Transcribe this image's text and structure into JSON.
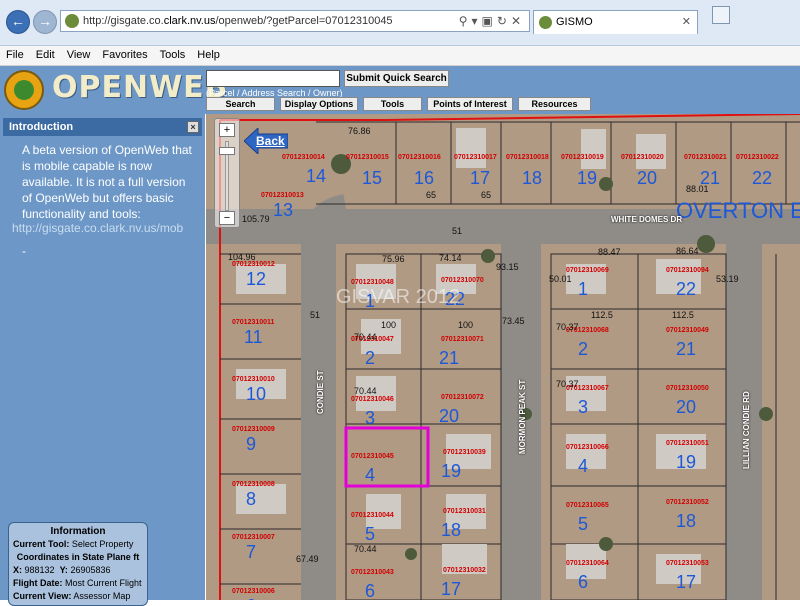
{
  "browser": {
    "url_prefix": "http://gisgate.co.",
    "url_host": "clark.nv.us",
    "url_suffix": "/openweb/?getParcel=07012310045",
    "tab_title": "GISMO",
    "menu": [
      "File",
      "Edit",
      "View",
      "Favorites",
      "Tools",
      "Help"
    ]
  },
  "app": {
    "brand": "OPENWEB",
    "search_placeholder": "",
    "submit_label": "Submit Quick Search",
    "search_hint": "(Parcel / Address Search / Owner)",
    "nav": [
      "Search",
      "Display Options",
      "Tools",
      "Points of Interest",
      "Resources"
    ]
  },
  "intro": {
    "title": "Introduction",
    "text": "A beta version of OpenWeb that is mobile capable is now available. It is not a full version of OpenWeb but offers basic functionality and tools:",
    "link": "http://gisgate.co.clark.nv.us/mob",
    "dash": "-"
  },
  "info": {
    "title": "Information",
    "current_tool_label": "Current Tool:",
    "current_tool": "Select Property",
    "coords_title": "Coordinates in State Plane ft",
    "x_label": "X:",
    "x": "988132",
    "y_label": "Y:",
    "y": "26905836",
    "flight_label": "Flight Date:",
    "flight": "Most Current Flight",
    "view_label": "Current View:",
    "view": "Assessor Map"
  },
  "map": {
    "back_label": "Back",
    "overton": "OVERTON E",
    "watermark": "GISVAR 2012",
    "streets": [
      "WHITE DOMES DR",
      "CONDIE ST",
      "MORMON PEAK ST",
      "LILLIAN CONDIE RD"
    ],
    "parcels": [
      {
        "id": "07012310014",
        "lot": "14"
      },
      {
        "id": "07012310015",
        "lot": "15"
      },
      {
        "id": "07012310016",
        "lot": "16"
      },
      {
        "id": "07012310017",
        "lot": "17"
      },
      {
        "id": "07012310018",
        "lot": "18"
      },
      {
        "id": "07012310019",
        "lot": "19"
      },
      {
        "id": "07012310020",
        "lot": "20"
      },
      {
        "id": "07012310021",
        "lot": "21"
      },
      {
        "id": "07012310022",
        "lot": "22"
      },
      {
        "id": "07012310013",
        "lot": "13"
      },
      {
        "id": "07012310012",
        "lot": "12"
      },
      {
        "id": "07012310011",
        "lot": "11"
      },
      {
        "id": "07012310010",
        "lot": "10"
      },
      {
        "id": "07012310009",
        "lot": "9"
      },
      {
        "id": "07012310008",
        "lot": "8"
      },
      {
        "id": "07012310007",
        "lot": "7"
      },
      {
        "id": "07012310006",
        "lot": "6"
      },
      {
        "id": "07012310048",
        "lot": "1"
      },
      {
        "id": "07012310070",
        "lot": "22"
      },
      {
        "id": "07012310047",
        "lot": "2"
      },
      {
        "id": "07012310071",
        "lot": "21"
      },
      {
        "id": "07012310046",
        "lot": "3"
      },
      {
        "id": "07012310072",
        "lot": "20"
      },
      {
        "id": "07012310045",
        "lot": "4"
      },
      {
        "id": "07012310039",
        "lot": "19"
      },
      {
        "id": "07012310044",
        "lot": "5"
      },
      {
        "id": "07012310031",
        "lot": "18"
      },
      {
        "id": "07012310043",
        "lot": "6"
      },
      {
        "id": "07012310032",
        "lot": "17"
      },
      {
        "id": "07012310069",
        "lot": "1"
      },
      {
        "id": "07012310094",
        "lot": "22"
      },
      {
        "id": "07012310068",
        "lot": "2"
      },
      {
        "id": "07012310049",
        "lot": "21"
      },
      {
        "id": "07012310067",
        "lot": "3"
      },
      {
        "id": "07012310050",
        "lot": "20"
      },
      {
        "id": "07012310066",
        "lot": "4"
      },
      {
        "id": "07012310051",
        "lot": "19"
      },
      {
        "id": "07012310065",
        "lot": "5"
      },
      {
        "id": "07012310052",
        "lot": "18"
      },
      {
        "id": "07012310064",
        "lot": "6"
      },
      {
        "id": "07012310053",
        "lot": "17"
      }
    ],
    "dims": [
      "76.86",
      "65",
      "88.01",
      "51",
      "75.96",
      "74.14",
      "88.47",
      "86.64",
      "100",
      "100",
      "112.5",
      "112.5",
      "70.44",
      "70.44",
      "70.37",
      "70.37",
      "70.44",
      "50.01",
      "53.19",
      "51",
      "65",
      "67.49",
      "104.96",
      "105.79",
      "93.15",
      "73.45"
    ]
  }
}
